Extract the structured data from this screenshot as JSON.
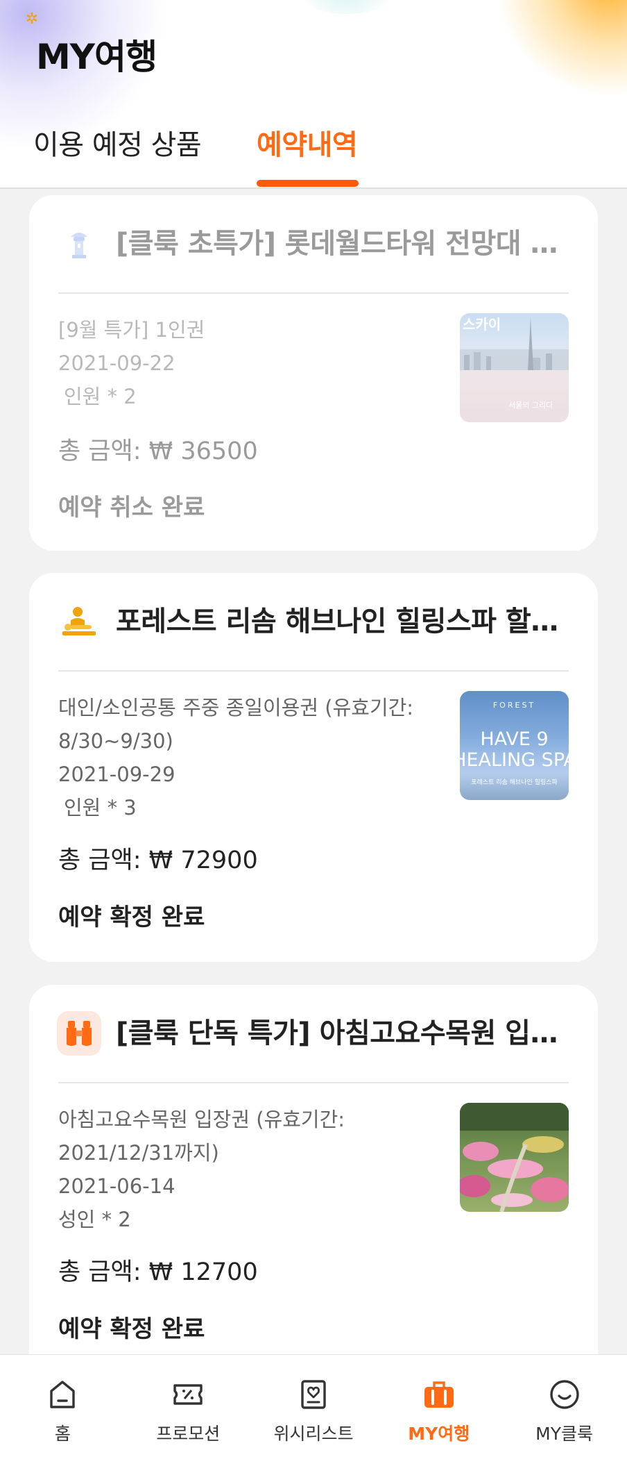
{
  "header": {
    "title": "MY여행",
    "tabs": [
      {
        "label": "이용 예정 상품",
        "active": false
      },
      {
        "label": "예약내역",
        "active": true
      }
    ]
  },
  "colors": {
    "accent": "#ff6a13",
    "confirmed": "#13a872",
    "cancelled": "#9a9a9a"
  },
  "bookings": [
    {
      "icon": "tower-icon",
      "title": "[클룩 초특가] 롯데월드타워 전망대 서...",
      "detail_lines": [
        "[9월 특가] 1인권"
      ],
      "date": "2021-09-22",
      "people": "인원 * 2",
      "total": "총 금액: ₩ 36500",
      "status": "예약 취소 완료",
      "state": "cancelled",
      "thumb_text": [
        "스카이",
        "서울의 그리다"
      ]
    },
    {
      "icon": "massage-icon",
      "title": "포레스트 리솜 해브나인 힐링스파 할인...",
      "detail_lines": [
        "대인/소인공통 주중 종일이용권 (유효기간:",
        "8/30~9/30)"
      ],
      "date": "2021-09-29",
      "people": "인원 * 3",
      "total": "총 금액: ₩ 72900",
      "status": "예약 확정 완료",
      "state": "confirmed",
      "thumb_text": [
        "FOREST",
        "HAVE 9",
        "HEALING SPA",
        "포레스트 리솜 해브나인 힐링스파"
      ]
    },
    {
      "icon": "binoculars-icon",
      "title": "[클룩 단독 특가] 아침고요수목원 입장...",
      "detail_lines": [
        "아침고요수목원 입장권 (유효기간:",
        "2021/12/31까지)"
      ],
      "date": "2021-06-14",
      "people": "성인 * 2",
      "total": "총 금액: ₩ 12700",
      "status": "예약 확정 완료",
      "state": "confirmed",
      "thumb_text": []
    }
  ],
  "bottom_nav": [
    {
      "label": "홈",
      "icon": "home-icon",
      "active": false
    },
    {
      "label": "프로모션",
      "icon": "coupon-icon",
      "active": false
    },
    {
      "label": "위시리스트",
      "icon": "wishlist-icon",
      "active": false
    },
    {
      "label": "MY여행",
      "icon": "suitcase-icon",
      "active": true
    },
    {
      "label": "MY클룩",
      "icon": "smile-icon",
      "active": false
    }
  ]
}
